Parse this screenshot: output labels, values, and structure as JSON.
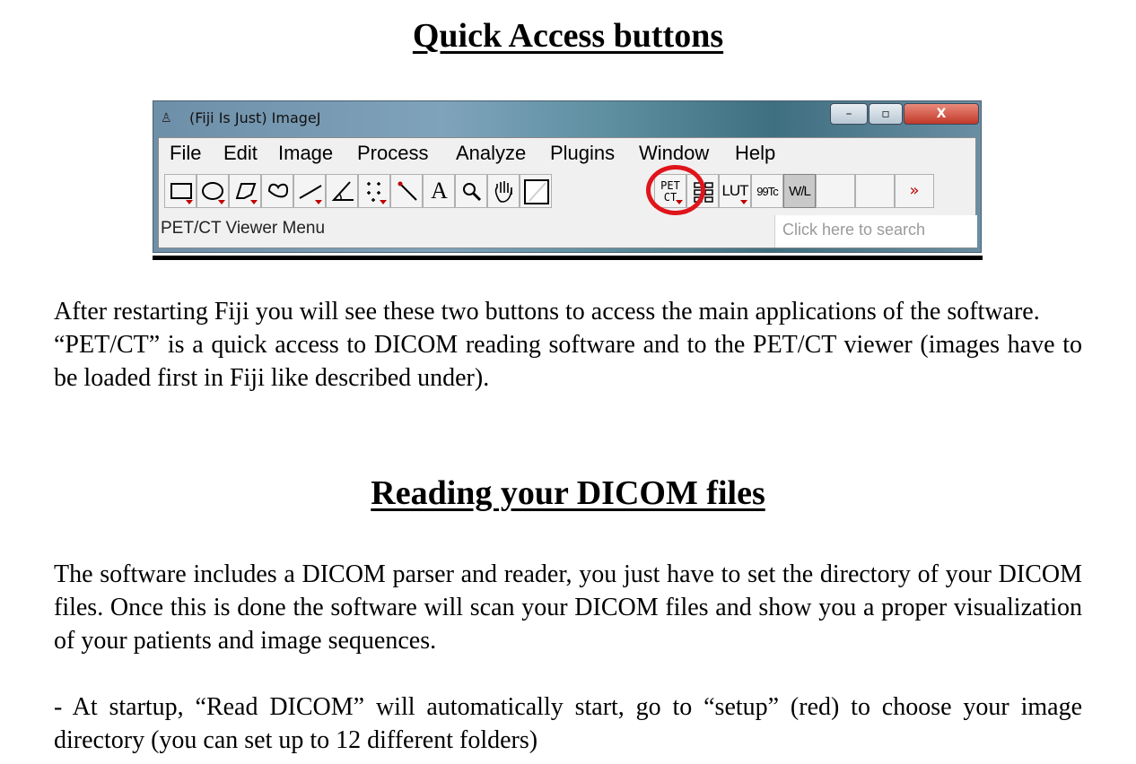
{
  "sections": [
    {
      "heading": "Quick Access buttons"
    },
    {
      "heading": "Reading your DICOM files"
    }
  ],
  "imagej": {
    "title": "(Fiji Is Just) ImageJ",
    "window_buttons": {
      "minimize": "–",
      "maximize": "▫",
      "close": "X"
    },
    "menu": [
      "File",
      "Edit",
      "Image",
      "Process",
      "Analyze",
      "Plugins",
      "Window",
      "Help"
    ],
    "tools": {
      "text_tool": "A",
      "petct_line1": "PET",
      "petct_line2": "CT",
      "lut": "LUT",
      "tc99": "99Tc",
      "wl": "W/L",
      "more": "»"
    },
    "status_text": "PET/CT Viewer Menu",
    "search_placeholder": "Click here to search",
    "highlight_color": "#e0141b"
  },
  "paragraphs": {
    "quick_access": [
      "After restarting Fiji you will see these two buttons to access the main applications of the software.",
      "“PET/CT” is a quick access to DICOM reading software and to the PET/CT viewer (images have to be loaded first in Fiji like described under)."
    ],
    "dicom": [
      "The software includes a DICOM parser and reader, you just have to set the directory of your DICOM files. Once this is done the software will scan your DICOM files and show you a proper visualization of your patients and image sequences.",
      "- At startup, “Read DICOM” will automatically start, go to “setup” (red) to choose your image directory  (you can set up to 12 different folders)"
    ]
  }
}
